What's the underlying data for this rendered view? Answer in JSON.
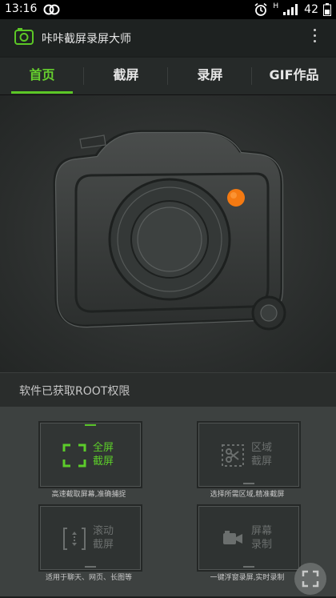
{
  "status_bar": {
    "time": "13:16",
    "h_label": "H",
    "battery": "42"
  },
  "app": {
    "title": "咔咔截屏录屏大师"
  },
  "tabs": [
    {
      "label": "首页",
      "active": true
    },
    {
      "label": "截屏",
      "active": false
    },
    {
      "label": "录屏",
      "active": false
    },
    {
      "label": "GIF作品",
      "active": false
    }
  ],
  "hero": {
    "accent_color": "#f47a12"
  },
  "root_status": "软件已获取ROOT权限",
  "tiles": [
    {
      "line1": "全屏",
      "line2": "截屏",
      "caption": "高速截取屏幕,准确捕捉",
      "icon": "fullscreen-frame-icon",
      "active": true
    },
    {
      "line1": "区域",
      "line2": "截屏",
      "caption": "选择所需区域,精准截屏",
      "icon": "scissors-region-icon",
      "active": false
    },
    {
      "line1": "滚动",
      "line2": "截屏",
      "caption": "适用于聊天、网页、长图等",
      "icon": "scroll-capture-icon",
      "active": false
    },
    {
      "line1": "屏幕",
      "line2": "录制",
      "caption": "一键浮窗录屏,实时录制",
      "icon": "video-camera-icon",
      "active": false
    }
  ],
  "colors": {
    "accent": "#5cc726",
    "background": "#1c1f1e"
  }
}
